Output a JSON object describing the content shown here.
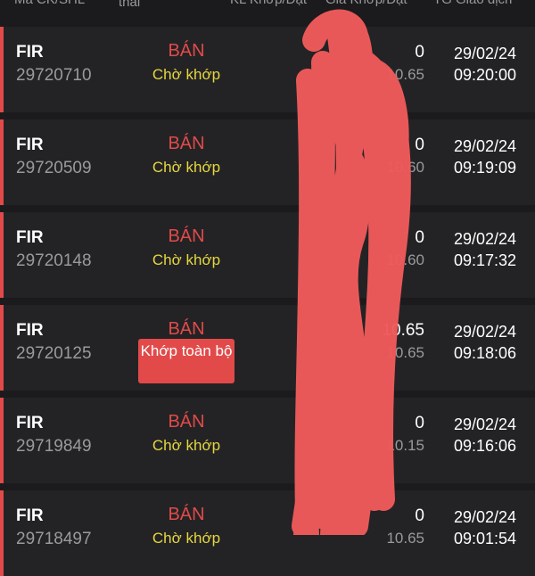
{
  "header": {
    "code_col": "Mã CK/SHL",
    "status_col_line1": "",
    "status_col_line2": "thái",
    "qty_col": "KL Khớp/Đặt",
    "price_col": "Giá Khớp/Đặt",
    "time_col": "TG Giao dịch"
  },
  "orders": [
    {
      "symbol": "FIR",
      "order_id": "29720710",
      "side": "BÁN",
      "status": "Chờ khớp",
      "qty": "0",
      "price": "10.65",
      "date": "29/02/24",
      "time": "09:20:00"
    },
    {
      "symbol": "FIR",
      "order_id": "29720509",
      "side": "BÁN",
      "status": "Chờ khớp",
      "qty": "0",
      "price": "10.60",
      "date": "29/02/24",
      "time": "09:19:09"
    },
    {
      "symbol": "FIR",
      "order_id": "29720148",
      "side": "BÁN",
      "status": "Chờ khớp",
      "qty": "0",
      "price": "10.60",
      "date": "29/02/24",
      "time": "09:17:32"
    },
    {
      "symbol": "FIR",
      "order_id": "29720125",
      "side": "BÁN",
      "status": "Khớp toàn bộ",
      "qty": "10.65",
      "price": "10.65",
      "date": "29/02/24",
      "time": "09:18:06"
    },
    {
      "symbol": "FIR",
      "order_id": "29719849",
      "side": "BÁN",
      "status": "Chờ khớp",
      "qty": "0",
      "price": "10.15",
      "date": "29/02/24",
      "time": "09:16:06"
    },
    {
      "symbol": "FIR",
      "order_id": "29718497",
      "side": "BÁN",
      "status": "Chờ khớp",
      "qty": "0",
      "price": "10.65",
      "date": "29/02/24",
      "time": "09:01:54"
    }
  ],
  "colors": {
    "background": "#1b1b1d",
    "row_background": "#232325",
    "sell_red": "#e24a4a",
    "pending_yellow": "#e6d640",
    "muted_gray": "#9a9a9e",
    "scribble": "#f05a5a"
  }
}
